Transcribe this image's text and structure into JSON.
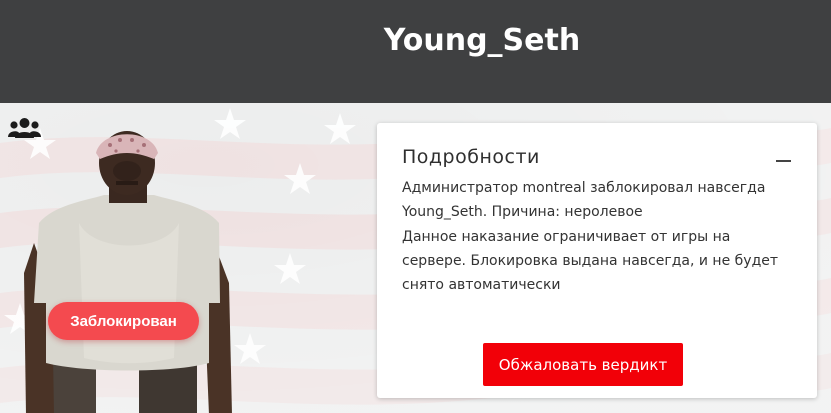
{
  "header": {
    "title": "Young_Seth"
  },
  "status": {
    "label": "Заблокирован"
  },
  "details": {
    "title": "Подробности",
    "line1": "Администратор montreal заблокировал навсегда Young_Seth. Причина: неролевое",
    "line2": "Данное наказание ограничивает от игры на сервере. Блокировка выдана навсегда, и не будет снято автоматически",
    "button_label": "Обжаловать вердикт"
  },
  "colors": {
    "header_bg": "#3f4041",
    "badge_bg": "#f44a4f",
    "button_bg": "#f20008"
  },
  "icons": {
    "group": "users-group-icon",
    "collapse": "minus-icon"
  }
}
